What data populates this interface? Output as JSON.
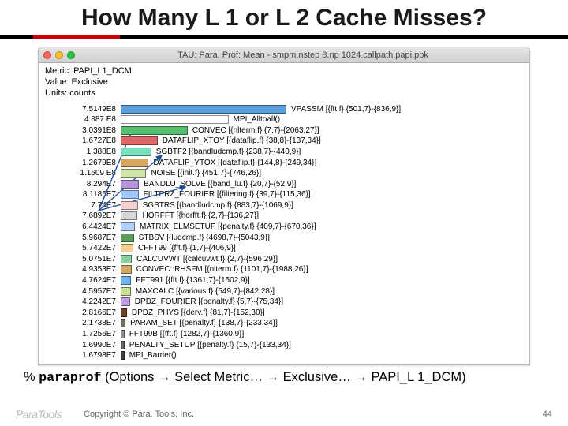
{
  "title": "How Many L 1 or L 2 Cache Misses?",
  "window": {
    "title": "TAU: Para. Prof: Mean - smpm.nstep 8.np 1024.callpath.papi.ppk",
    "meta": {
      "metric_label": "Metric:",
      "metric_value": "PAPI_L1_DCM",
      "value_label": "Value:",
      "value_value": "Exclusive",
      "units_label": "Units:",
      "units_value": "counts"
    }
  },
  "chart_data": {
    "type": "bar",
    "xlabel": "",
    "ylabel": "",
    "max_value": 751490000.0,
    "series": [
      {
        "label_num": "7.5149E8",
        "value": 751490000,
        "color": "#5aa0dc",
        "name": "VPASSM [{fft.f} {501,7}-{836,9}]"
      },
      {
        "label_num": "4.887 E8",
        "value": 488700000,
        "color": "#ffffff",
        "name": "MPI_Alltoall()"
      },
      {
        "label_num": "3.0391E8",
        "value": 303910000,
        "color": "#54c06e",
        "name": "CONVEC [{nlterm.f} {7,7}-{2063,27}]"
      },
      {
        "label_num": "1.6727E8",
        "value": 167270000,
        "color": "#e06868",
        "name": "DATAFLIP_XTOY [{dataflip.f} {38,8}-{137,34}]"
      },
      {
        "label_num": "1.388E8",
        "value": 138800000,
        "color": "#7be0c0",
        "name": "SGBTF2 [{bandludcmp.f} {238,7}-{440,9}]"
      },
      {
        "label_num": "1.2679E8",
        "value": 126790000,
        "color": "#d8a860",
        "name": "DATAFLIP_YTOX [{dataflip.f} {144,8}-{249,34}]"
      },
      {
        "label_num": "1.1609 E8",
        "value": 116090000,
        "color": "#cfe6a8",
        "name": "NOISE [{init.f} {451,7}-{746,26}]"
      },
      {
        "label_num": "8.294E7",
        "value": 82940000,
        "color": "#b694d8",
        "name": "BANDLU_SOLVE [{band_lu.f} {20,7}-{52,9}]"
      },
      {
        "label_num": "8.1185E7",
        "value": 81185000,
        "color": "#a0c8ff",
        "name": "FILTERZ_FOURIER [{filtering.f} {39,7}-{115,36}]"
      },
      {
        "label_num": "7.74E7",
        "value": 77400000,
        "color": "#f4d0d0",
        "name": "SGBTRS [{bandludcmp.f} {883,7}-{1069,9}]"
      },
      {
        "label_num": "7.6892E7",
        "value": 76892000,
        "color": "#d8d8d8",
        "name": "HORFFT [{horfft.f} {2,7}-{136,27}]"
      },
      {
        "label_num": "6.4424E7",
        "value": 64424000,
        "color": "#b0d0ff",
        "name": "MATRIX_ELMSETUP [{penalty.f} {409,7}-{670,36}]"
      },
      {
        "label_num": "5.9687E7",
        "value": 59687000,
        "color": "#5a9e5a",
        "name": "STBSV [{ludcmp.f} {4698,7}-{5043,9}]"
      },
      {
        "label_num": "5.7422E7",
        "value": 57422000,
        "color": "#f4d090",
        "name": "CFFT99 [{fft.f} {1,7}-{406,9}]"
      },
      {
        "label_num": "5.0751E7",
        "value": 50751000,
        "color": "#8ad0a0",
        "name": "CALCUVWT [{calcuvwt.f} {2,7}-{596,29}]"
      },
      {
        "label_num": "4.9353E7",
        "value": 49353000,
        "color": "#d0a860",
        "name": "CONVEC::RHSFM [{nlterm.f} {1101,7}-{1988,26}]"
      },
      {
        "label_num": "4.7624E7",
        "value": 47624000,
        "color": "#70b4f0",
        "name": "FFT991 [{fft.f} {1361,7}-{1502,9}]"
      },
      {
        "label_num": "4.5957E7",
        "value": 45957000,
        "color": "#c8e090",
        "name": "MAXCALC [{various.f} {549,7}-{842,28}]"
      },
      {
        "label_num": "4.2242E7",
        "value": 42242000,
        "color": "#c8a0e8",
        "name": "DPDZ_FOURIER [{penalty.f} {5,7}-{75,34}]"
      },
      {
        "label_num": "2.8166E7",
        "value": 28166000,
        "color": "#704030",
        "name": "DPDZ_PHYS [{derv.f} {81,7}-{152,30}]"
      },
      {
        "label_num": "2.1738E7",
        "value": 21738000,
        "color": "#707060",
        "name": "PARAM_SET [{penalty.f} {138,7}-{233,34}]"
      },
      {
        "label_num": "1.7256E7",
        "value": 17256000,
        "color": "#909090",
        "name": "FFT99B [{fft.f} {1282,7}-{1360,9}]"
      },
      {
        "label_num": "1.6990E7",
        "value": 16990000,
        "color": "#606060",
        "name": "PENALTY_SETUP [{penalty.f} {15,7}-{133,34}]"
      },
      {
        "label_num": "1.6798E7",
        "value": 16798000,
        "color": "#404040",
        "name": "MPI_Barrier()"
      }
    ]
  },
  "command": {
    "prefix": "% ",
    "cmd": "paraprof",
    "rest_1": " (Options ",
    "arrow": "→",
    "rest_2": " Select Metric… ",
    "rest_3": " Exclusive… ",
    "rest_4": " PAPI_L 1_DCM)"
  },
  "footer": {
    "logo": "ParaTools",
    "copyright": "Copyright © Para. Tools, Inc.",
    "page": "44"
  }
}
